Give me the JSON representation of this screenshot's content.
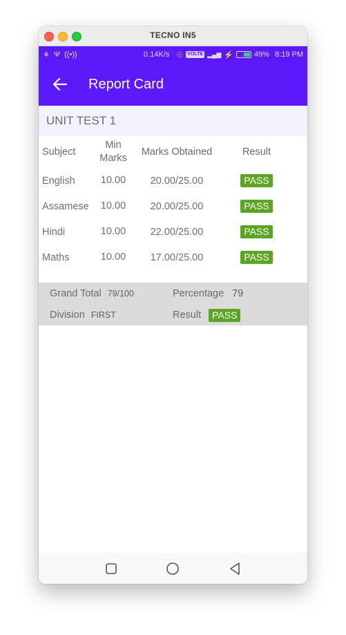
{
  "window": {
    "title": "TECNO IN5"
  },
  "status_bar": {
    "left_icons": [
      "usb-debug-icon",
      "usb-icon",
      "hotspot-icon"
    ],
    "net_speed": "0.14K/s",
    "volte": "VOLTE",
    "network": "4G",
    "battery_percent": "49%",
    "battery_level": 0.49,
    "time": "8:19 PM"
  },
  "app_bar": {
    "title": "Report Card",
    "back_icon": "arrow-left-icon"
  },
  "section": {
    "title": "UNIT TEST 1"
  },
  "table": {
    "headers": {
      "subject": "Subject",
      "min_marks": "Min Marks",
      "marks_obtained": "Marks Obtained",
      "result": "Result"
    },
    "rows": [
      {
        "subject": "English",
        "min_marks": "10.00",
        "marks_obtained": "20.00/25.00",
        "result": "PASS"
      },
      {
        "subject": "Assamese",
        "min_marks": "10.00",
        "marks_obtained": "20.00/25.00",
        "result": "PASS"
      },
      {
        "subject": "Hindi",
        "min_marks": "10.00",
        "marks_obtained": "22.00/25.00",
        "result": "PASS"
      },
      {
        "subject": "Maths",
        "min_marks": "10.00",
        "marks_obtained": "17.00/25.00",
        "result": "PASS"
      }
    ]
  },
  "summary": {
    "grand_total_label": "Grand Total",
    "grand_total_value": "79/100",
    "percentage_label": "Percentage",
    "percentage_value": "79",
    "division_label": "Division",
    "division_value": "FIRST",
    "result_label": "Result",
    "result_value": "PASS"
  },
  "nav_bar": {
    "buttons": [
      "recents-square-icon",
      "home-circle-icon",
      "back-triangle-icon"
    ]
  },
  "colors": {
    "primary": "#5b19f9",
    "pass": "#5ba523",
    "section_bg": "#f1f2fb",
    "summary_bg": "#dcdada"
  }
}
